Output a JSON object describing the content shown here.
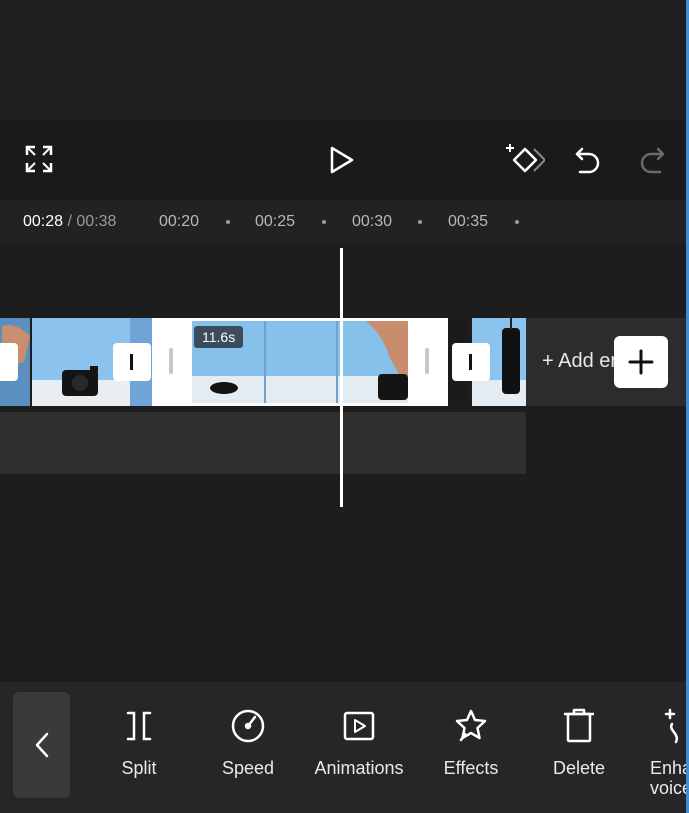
{
  "preview": {},
  "controls": {
    "fullscreen_icon": "fullscreen-icon",
    "play_icon": "play-icon",
    "keyframe_icon": "keyframe-add-icon",
    "undo_icon": "undo-icon",
    "redo_icon": "redo-icon"
  },
  "ruler": {
    "current_time": "00:28",
    "total_time": "/ 00:38",
    "ticks": [
      "00:20",
      "00:25",
      "00:30",
      "00:35"
    ]
  },
  "timeline": {
    "selected_clip_duration": "11.6s",
    "add_ending_label": "+ Add ending"
  },
  "toolbar": {
    "items": [
      {
        "label": "Split",
        "icon": "split-icon"
      },
      {
        "label": "Speed",
        "icon": "speed-icon"
      },
      {
        "label": "Animations",
        "icon": "animations-icon"
      },
      {
        "label": "Effects",
        "icon": "effects-icon"
      },
      {
        "label": "Delete",
        "icon": "delete-icon"
      },
      {
        "label": "Enhance voice",
        "icon": "enhance-voice-icon"
      }
    ]
  },
  "colors": {
    "background": "#1d1d1d",
    "toolbar": "#262626",
    "selection": "#ffffff",
    "accent_edge": "#3c8fd6"
  }
}
